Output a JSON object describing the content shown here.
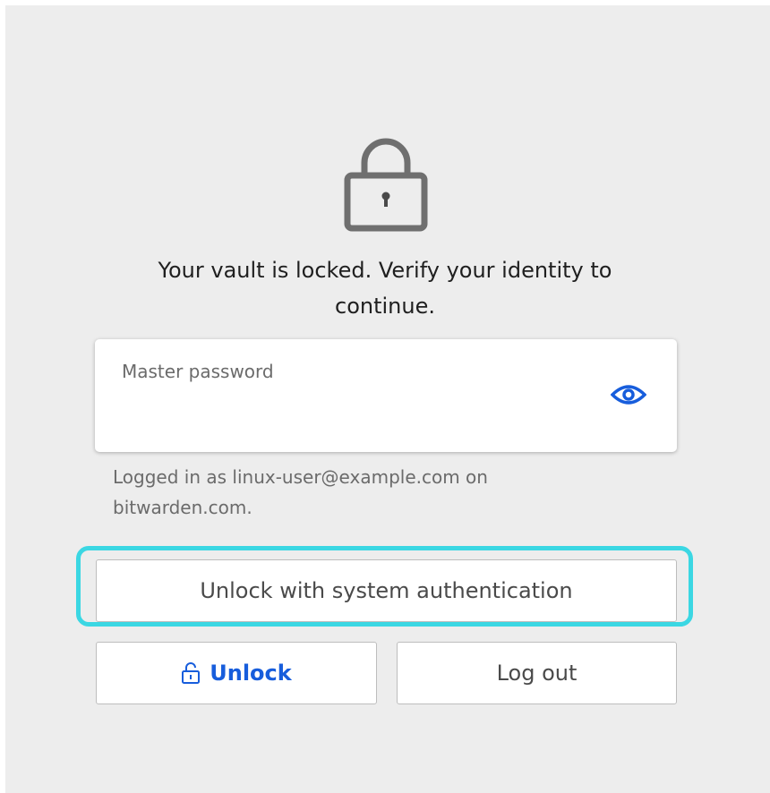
{
  "lock_screen": {
    "icon": "lock-icon",
    "message": "Your vault is locked. Verify your identity to continue."
  },
  "password_field": {
    "label": "Master password",
    "value": "",
    "toggle_icon": "eye-icon"
  },
  "account_info": "Logged in as linux-user@example.com on bitwarden.com.",
  "buttons": {
    "system_auth_label": "Unlock with system authentication",
    "unlock_label": "Unlock",
    "unlock_icon": "unlocked-padlock-icon",
    "logout_label": "Log out"
  },
  "colors": {
    "accent": "#175ddc",
    "focus_ring": "#3bd7e3",
    "background": "#ededed"
  }
}
